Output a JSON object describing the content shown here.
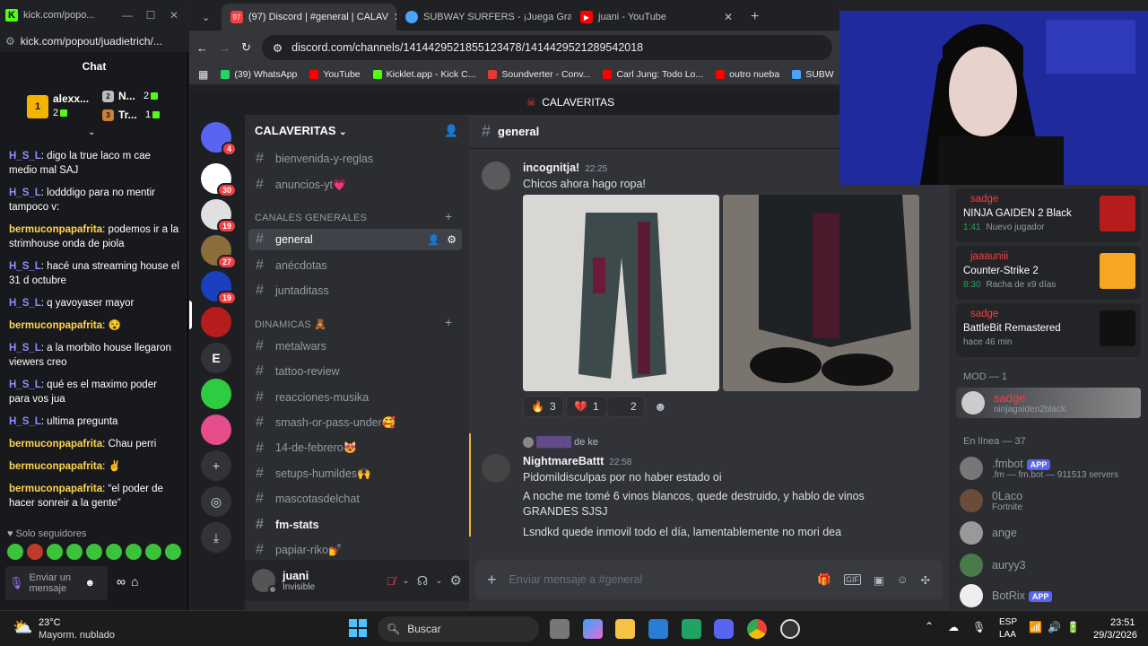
{
  "kick": {
    "tab_title": "kick.com/popo...",
    "url": "kick.com/popout/juadietrich/...",
    "chat_header": "Chat",
    "leaderboard": [
      {
        "name": "alexx...",
        "gifts": "2"
      },
      {
        "name": "N...",
        "gifts": "2"
      },
      {
        "name": "Tr...",
        "gifts": "1"
      }
    ],
    "messages": [
      {
        "user": "H_S_L",
        "color": "#8f8fff",
        "text": ": digo la true laco m cae medio mal SAJ"
      },
      {
        "user": "H_S_L",
        "color": "#8f8fff",
        "text": ": lodddigo para no mentir tampoco v:"
      },
      {
        "user": "bermuconpapafrita",
        "color": "#ffd54f",
        "text": ": podemos ir a la strimhouse onda de piola"
      },
      {
        "user": "H_S_L",
        "color": "#8f8fff",
        "text": ": hacé una streaming house el 31 d octubre"
      },
      {
        "user": "H_S_L",
        "color": "#8f8fff",
        "text": ": q yavoyaser mayor"
      },
      {
        "user": "bermuconpapafrita",
        "color": "#ffd54f",
        "text": ": 😵"
      },
      {
        "user": "H_S_L",
        "color": "#8f8fff",
        "text": ": a la morbito house llegaron viewers creo"
      },
      {
        "user": "H_S_L",
        "color": "#8f8fff",
        "text": ": qué es el maximo poder para vos jua"
      },
      {
        "user": "H_S_L",
        "color": "#8f8fff",
        "text": ": ultima pregunta"
      },
      {
        "user": "bermuconpapafrita",
        "color": "#ffd54f",
        "text": ": Chau perri"
      },
      {
        "user": "bermuconpapafrita",
        "color": "#ffd54f",
        "text": ": ✌"
      },
      {
        "user": "bermuconpapafrita",
        "color": "#ffd54f",
        "text": ": “el poder de hacer sonreir a la gente”"
      }
    ],
    "followers_only": "Solo seguidores",
    "input_placeholder": "Enviar un mensaje"
  },
  "chrome": {
    "tabs": [
      {
        "title": "(97) Discord | #general | CALAV",
        "color": "#f23f43",
        "badge": "97"
      },
      {
        "title": "SUBWAY SURFERS - ¡Juega Gra",
        "color": "#4aa3ff",
        "badge": ""
      },
      {
        "title": "juani - YouTube",
        "color": "#ff0000",
        "badge": ""
      }
    ],
    "url": "discord.com/channels/1414429521855123478/1414429521289542018",
    "bookmarks": [
      {
        "label": "(39) WhatsApp",
        "color": "#25d366"
      },
      {
        "label": "YouTube",
        "color": "#ff0000"
      },
      {
        "label": "Kicklet.app - Kick C...",
        "color": "#53fc18"
      },
      {
        "label": "Soundverter - Conv...",
        "color": "#e53935"
      },
      {
        "label": "Carl Jung: Todo Lo...",
        "color": "#ff0000"
      },
      {
        "label": "outro nueba",
        "color": "#ff0000"
      },
      {
        "label": "SUBW",
        "color": "#4aa3ff"
      }
    ]
  },
  "discord": {
    "topbar_title": "CALAVERITAS",
    "server_name": "CALAVERITAS",
    "servers": [
      {
        "label": "",
        "badge": "4",
        "color": "#5865f2"
      },
      {
        "label": "",
        "badge": "30",
        "color": "#ffffff"
      },
      {
        "label": "",
        "badge": "19",
        "color": "#e0e0e0"
      },
      {
        "label": "",
        "badge": "27",
        "color": "#8a6d3b"
      },
      {
        "label": "",
        "badge": "19",
        "color": "#1a3fbf"
      },
      {
        "label": "",
        "badge": "",
        "color": "#b71c1c"
      },
      {
        "label": "E",
        "badge": "",
        "color": "#313338"
      },
      {
        "label": "",
        "badge": "",
        "color": "#2ecc40"
      },
      {
        "label": "",
        "badge": "",
        "color": "#e74c8c"
      }
    ],
    "top_channels": [
      "bienvenida-y-reglas",
      "anuncios-yt💗"
    ],
    "category_general": "CANALES GENERALES",
    "general_channels": [
      "general",
      "anécdotas",
      "juntaditass"
    ],
    "category_dinamicas": "DINAMICAS 🧸",
    "dinamicas_channels": [
      "metalwars",
      "tattoo-review",
      "reacciones-musika",
      "smash-or-pass-under🥰",
      "14-de-febrero😻",
      "setups-humildes🙌",
      "mascotasdelchat",
      "fm-stats",
      "papiar-riko💅"
    ],
    "user": {
      "name": "juani",
      "status": "Invisible"
    },
    "channel_header": "general",
    "messages": [
      {
        "author": "incognitja!",
        "time": "22:25",
        "text": "Chicos ahora hago ropa!"
      },
      {
        "author": "NightmareBattt",
        "time": "22:58",
        "reply_suffix": "de ke",
        "lines": [
          "Pidomildisculpas por no haber estado oi",
          "A noche me tomé 6 vinos blancos, quede destruido, y hablo de vinos GRANDES SJSJ",
          "Lsndkd quede inmovil todo el día, lamentablemente no mori dea"
        ]
      }
    ],
    "reactions": [
      {
        "emoji": "🔥",
        "count": "3"
      },
      {
        "emoji": "💔",
        "count": "1"
      },
      {
        "emoji": "",
        "count": "2"
      }
    ],
    "composer_placeholder": "Enviar mensaje a #general",
    "activities": [
      {
        "user": "sadge",
        "game": "NINJA GAIDEN 2 Black",
        "time": "1:41",
        "detail": "Nuevo jugador",
        "color": "#b71c1c"
      },
      {
        "user": "jaaauniii",
        "game": "Counter-Strike 2",
        "time": "8:30",
        "detail": "Racha de x9 días",
        "color": "#f5a623"
      },
      {
        "user": "sadge",
        "game": "BattleBit Remastered",
        "time": "",
        "detail": "hace 46 min",
        "color": "#111111"
      }
    ],
    "mod_header": "MOD — 1",
    "mod": {
      "name": "sadge",
      "sub": "ninjagaiden2black"
    },
    "online_header": "En línea — 37",
    "online": [
      {
        "name": ".fmbot",
        "app": "APP",
        "sub": ".fm — fm.bot — 911513 servers"
      },
      {
        "name": "0Laco",
        "app": "",
        "sub": "Fortnite"
      },
      {
        "name": "ange",
        "app": "",
        "sub": ""
      },
      {
        "name": "auryy3",
        "app": "",
        "sub": ""
      },
      {
        "name": "BotRix",
        "app": "APP",
        "sub": ""
      }
    ]
  },
  "taskbar": {
    "weather_temp": "23°C",
    "weather_desc": "Mayorm. nublado",
    "search": "Buscar",
    "lang": "ESP",
    "lang2": "LAA",
    "time": "23:51",
    "date": "29/3/2026"
  }
}
